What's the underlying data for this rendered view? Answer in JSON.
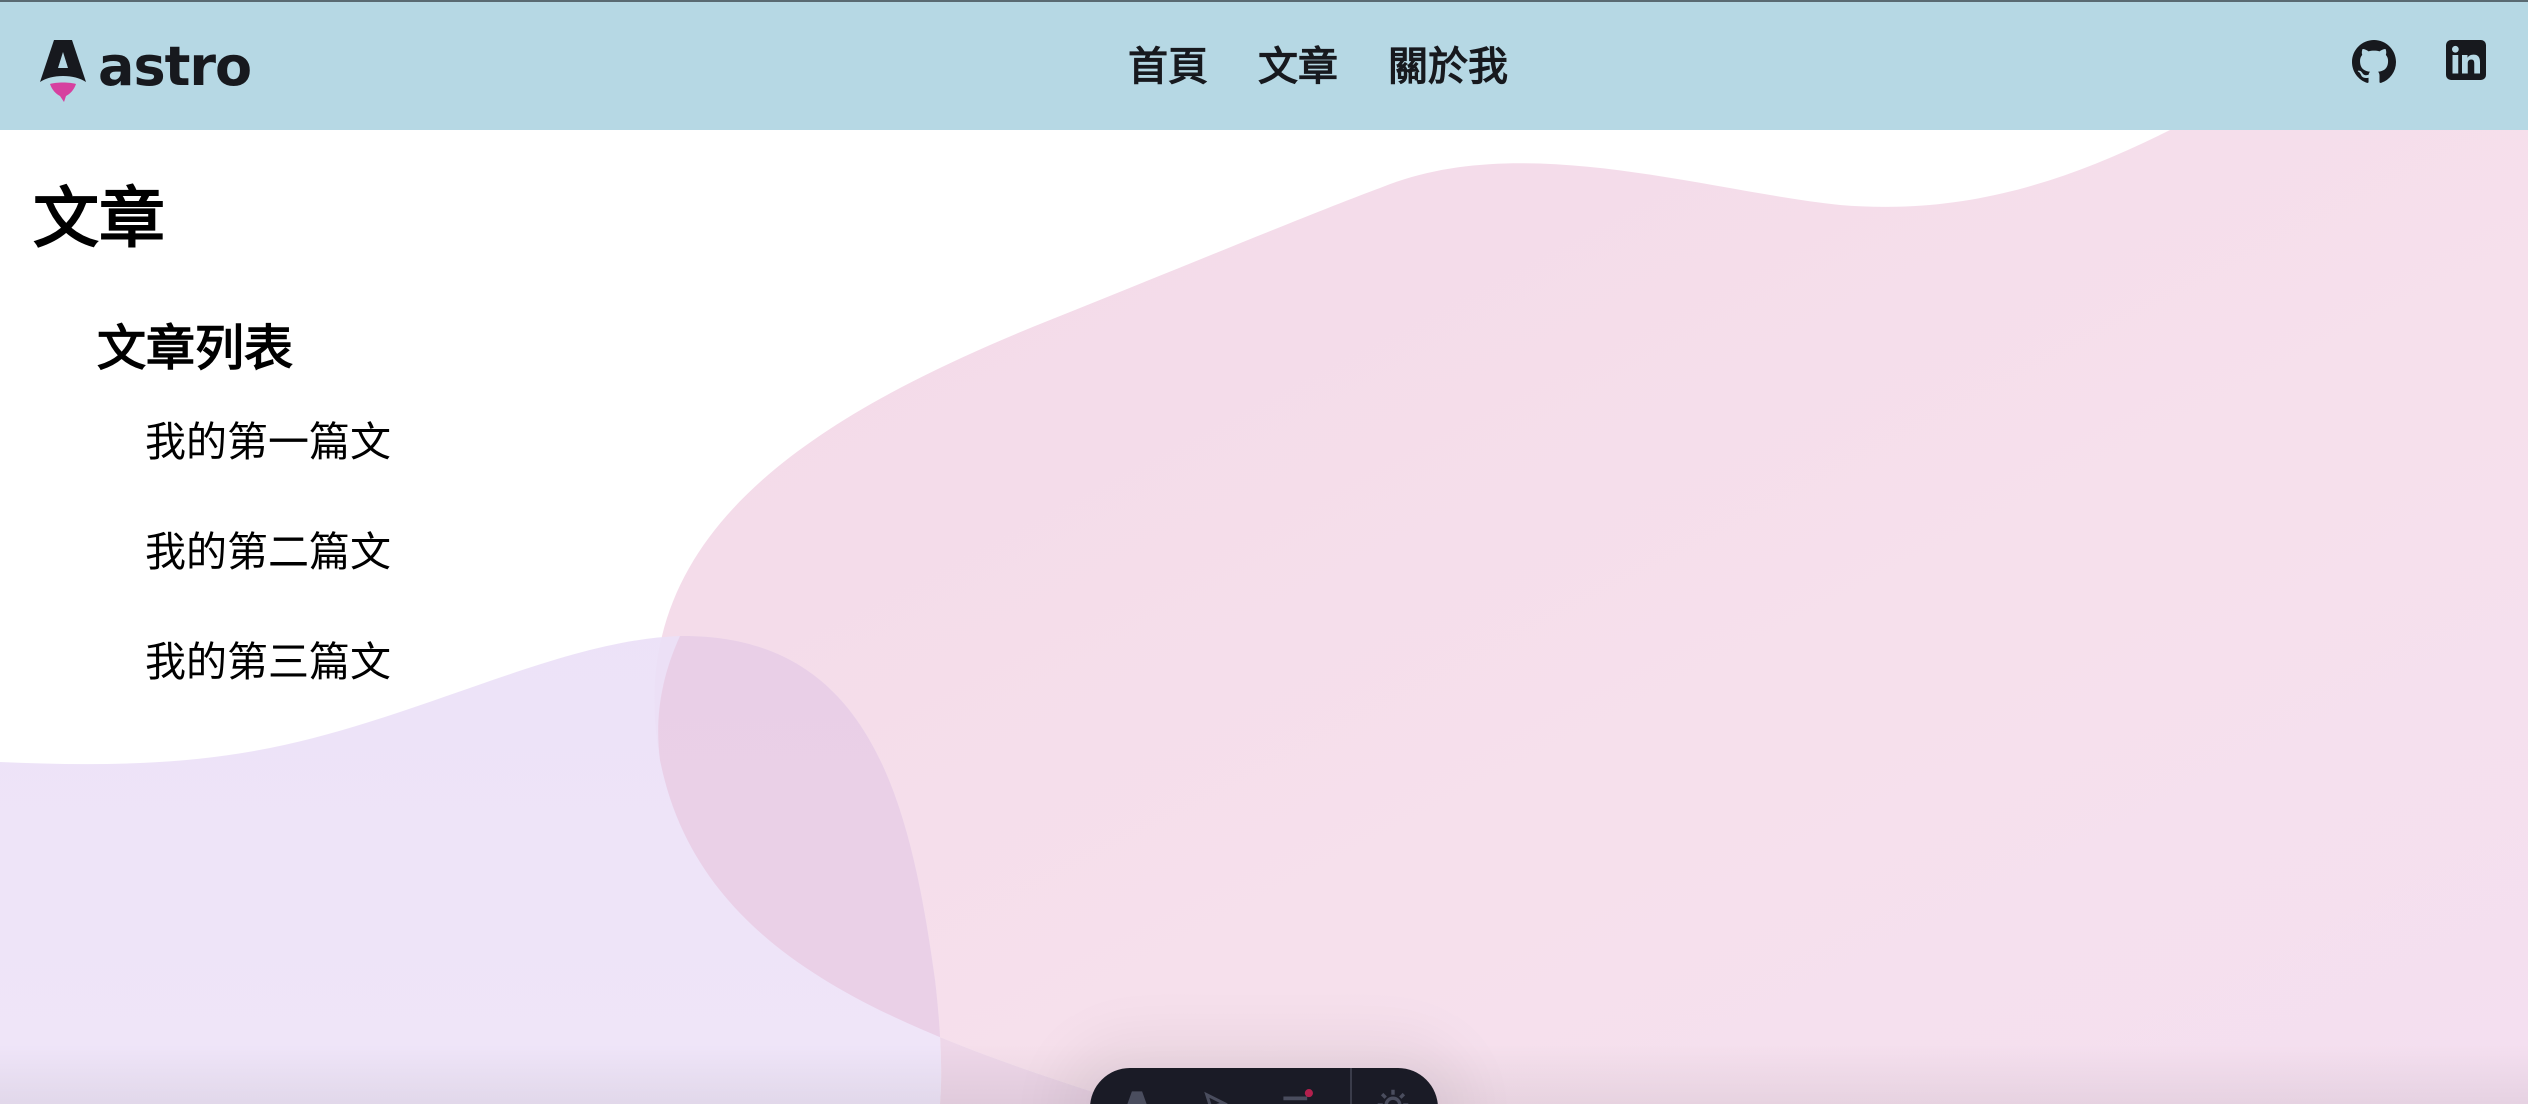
{
  "brand": {
    "wordmark": "astro",
    "colors": {
      "header_bg": "#b6d8e4",
      "text": "#17191e",
      "logo_accent": "#d6409f",
      "blob_pink": "#f5dbe8",
      "blob_purple": "#ece2f8",
      "toolbar_bg": "#1a1b26"
    }
  },
  "nav": {
    "home": "首頁",
    "articles": "文章",
    "about": "關於我"
  },
  "social": {
    "github_icon": "github-icon",
    "linkedin_icon": "linkedin-icon"
  },
  "main": {
    "title": "文章",
    "section_title": "文章列表",
    "posts": [
      {
        "title": "我的第一篇文"
      },
      {
        "title": "我的第二篇文"
      },
      {
        "title": "我的第三篇文"
      }
    ]
  },
  "dev_toolbar": {
    "icons": [
      "astro-menu-icon",
      "inspect-icon",
      "audit-icon",
      "settings-icon"
    ]
  }
}
